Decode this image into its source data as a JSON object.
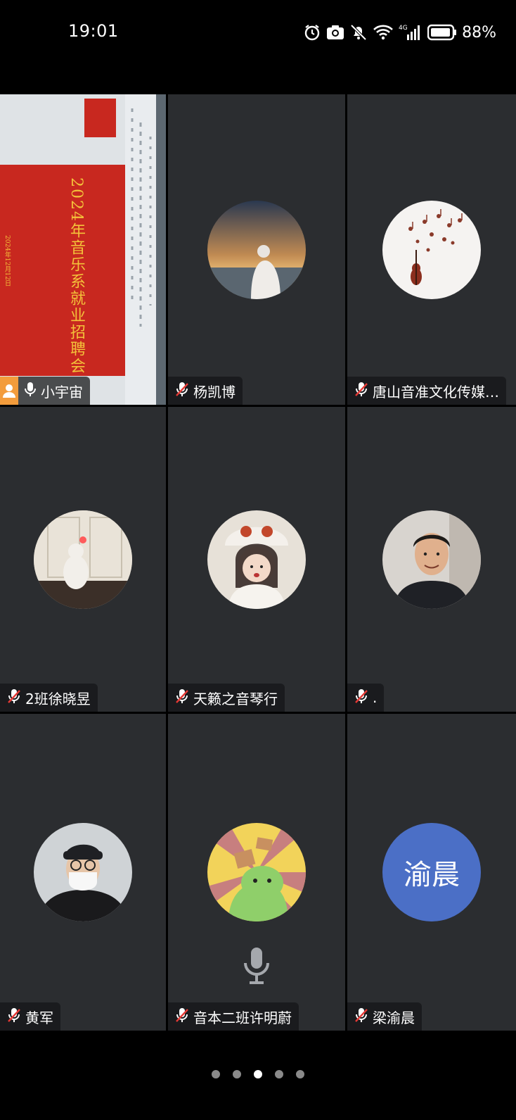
{
  "status_bar": {
    "time": "19:01",
    "battery": "88%",
    "network": "4G",
    "icons": [
      "alarm-icon",
      "camera-icon",
      "bell-muted-icon",
      "wifi-icon",
      "signal-icon",
      "battery-icon"
    ]
  },
  "participants": [
    {
      "name": "小宇宙",
      "mic": "on",
      "sharing": true,
      "avatar": "screen-share"
    },
    {
      "name": "杨凯博",
      "mic": "muted",
      "avatar": "sunset-photo"
    },
    {
      "name": "唐山音准文化传媒…",
      "mic": "muted",
      "avatar": "violin-notes"
    },
    {
      "name": "2班徐晓昱",
      "mic": "muted",
      "avatar": "cat-photo"
    },
    {
      "name": "天籁之音琴行",
      "mic": "muted",
      "avatar": "girl-photo"
    },
    {
      "name": ".",
      "mic": "muted",
      "avatar": "man-photo"
    },
    {
      "name": "黄军",
      "mic": "muted",
      "avatar": "masked-man-photo"
    },
    {
      "name": "音本二班许明蔚",
      "mic": "muted",
      "avatar": "cartoon-cat",
      "show_large_mic": true
    },
    {
      "name": "梁渝晨",
      "mic": "muted",
      "avatar_initials": "渝晨"
    }
  ],
  "share_content": {
    "slide_title": "2024年音乐系就业招聘会",
    "slide_date": "2024年12月12日"
  },
  "pager": {
    "count": 5,
    "active_index": 2
  },
  "colors": {
    "tile_bg": "#2b2d30",
    "active_border": "#34c759",
    "slide_red": "#c8281f",
    "slide_text": "#f3c23a",
    "initial_avatar": "#4b6fc6",
    "share_badge": "#f39c3c"
  }
}
